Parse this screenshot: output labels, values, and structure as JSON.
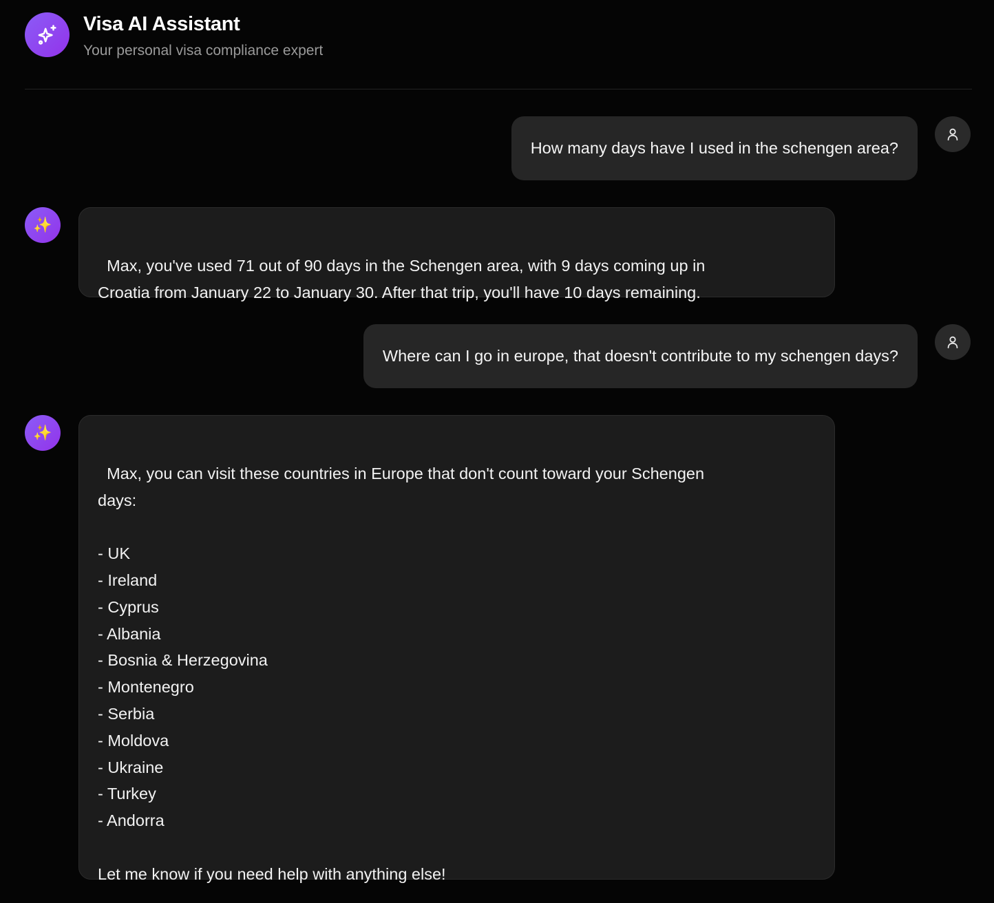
{
  "header": {
    "title": "Visa AI Assistant",
    "subtitle": "Your personal visa compliance expert",
    "logo_icon": "sparkles-icon"
  },
  "colors": {
    "background": "#050505",
    "accent": "#8b5cf6",
    "user_bubble": "#262626",
    "bot_bubble": "#1c1c1c"
  },
  "messages": [
    {
      "role": "user",
      "text": "How many days have I used in the schengen area?",
      "avatar_icon": "user-icon"
    },
    {
      "role": "assistant",
      "text": "Max, you've used 71 out of 90 days in the Schengen area, with 9 days coming up in\nCroatia from January 22 to January 30. After that trip, you'll have 10 days remaining.",
      "avatar_icon": "sparkles-emoji-icon"
    },
    {
      "role": "user",
      "text": "Where can I go in europe, that doesn't contribute to my schengen days?",
      "avatar_icon": "user-icon"
    },
    {
      "role": "assistant",
      "text": "Max, you can visit these countries in Europe that don't count toward your Schengen\ndays:\n\n- UK\n- Ireland\n- Cyprus\n- Albania\n- Bosnia & Herzegovina\n- Montenegro\n- Serbia\n- Moldova\n- Ukraine\n- Turkey\n- Andorra\n\nLet me know if you need help with anything else!",
      "avatar_icon": "sparkles-emoji-icon"
    }
  ]
}
